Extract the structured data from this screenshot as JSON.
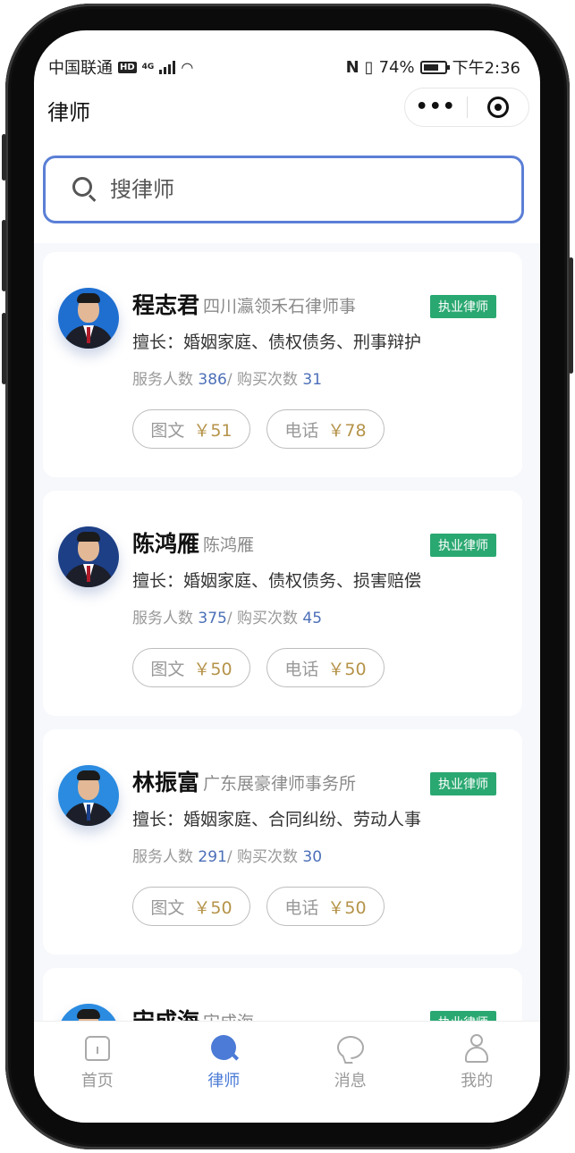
{
  "status_bar": {
    "carrier": "中国联通",
    "hd": "HD",
    "network": "4G",
    "battery_percent": "74%",
    "battery_level": 0.74,
    "time": "下午2:36"
  },
  "nav": {
    "title": "律师",
    "more_label": "•••"
  },
  "search": {
    "placeholder": "搜律师"
  },
  "lawyers": [
    {
      "name": "程志君",
      "firm": "四川瀛领禾石律师事",
      "badge": "执业律师",
      "specialty": "擅长：婚姻家庭、债权债务、刑事辩护",
      "served_label": "服务人数",
      "served": "386",
      "purchases_label": "/ 购买次数",
      "purchases": "31",
      "text_label": "图文",
      "text_price": "￥51",
      "phone_label": "电话",
      "phone_price": "￥78"
    },
    {
      "name": "陈鸿雁",
      "firm": "陈鸿雁",
      "badge": "执业律师",
      "specialty": "擅长：婚姻家庭、债权债务、损害赔偿",
      "served_label": "服务人数",
      "served": "375",
      "purchases_label": "/ 购买次数",
      "purchases": "45",
      "text_label": "图文",
      "text_price": "￥50",
      "phone_label": "电话",
      "phone_price": "￥50"
    },
    {
      "name": "林振富",
      "firm": "广东展豪律师事务所",
      "badge": "执业律师",
      "specialty": "擅长：婚姻家庭、合同纠纷、劳动人事",
      "served_label": "服务人数",
      "served": "291",
      "purchases_label": "/ 购买次数",
      "purchases": "30",
      "text_label": "图文",
      "text_price": "￥50",
      "phone_label": "电话",
      "phone_price": "￥50"
    },
    {
      "name": "宋成海",
      "firm": "宋成海",
      "badge": "执业律师"
    }
  ],
  "tabs": [
    {
      "label": "首页",
      "icon": "home-icon",
      "active": false
    },
    {
      "label": "律师",
      "icon": "lawyer-search-icon",
      "active": true
    },
    {
      "label": "消息",
      "icon": "message-icon",
      "active": false
    },
    {
      "label": "我的",
      "icon": "profile-icon",
      "active": false
    }
  ],
  "colors": {
    "accent": "#4b7bd6",
    "badge_green": "#2aa871",
    "price_gold": "#b59349",
    "stat_blue": "#4c6fb8"
  }
}
